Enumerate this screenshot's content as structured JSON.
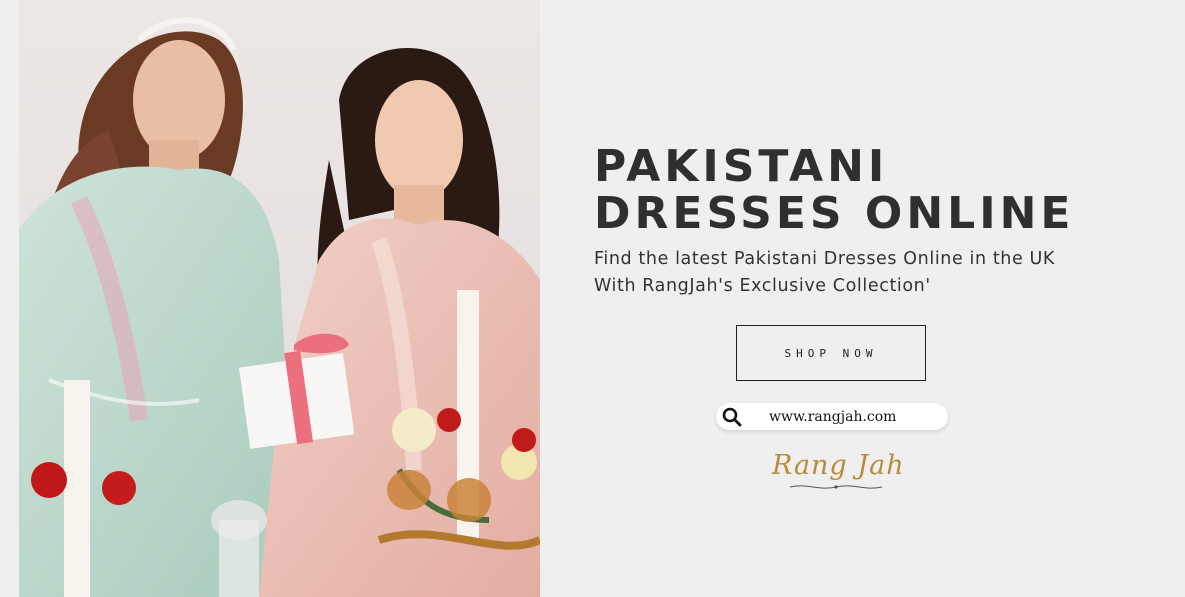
{
  "hero": {
    "title_line1": "PAKISTANI",
    "title_line2": "DRESSES ONLINE",
    "subtitle_line1": "Find the latest Pakistani Dresses Online in the UK",
    "subtitle_line2": "With RangJah's Exclusive Collection'",
    "cta_label": "SHOP NOW"
  },
  "search": {
    "icon": "search-icon",
    "url": "www.rangjah.com"
  },
  "brand": {
    "logo_text": "Rang Jah",
    "logo_color": "#b88a3a"
  },
  "image": {
    "subject": "two-women-in-pastel-embroidered-dresses-with-gift-box"
  },
  "colors": {
    "background": "#f0efef",
    "text": "#2f2f2f"
  }
}
